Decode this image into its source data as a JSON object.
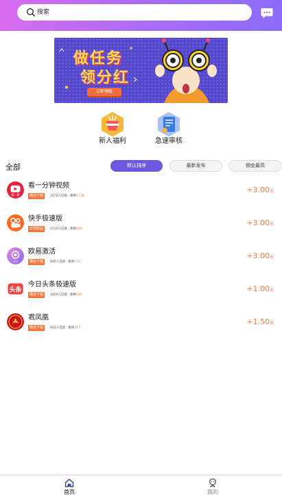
{
  "header": {
    "search_placeholder": "搜索",
    "gradient": [
      "#d86cf0",
      "#8a6cf7"
    ],
    "search_icon": "search-icon",
    "message_icon": "message-icon"
  },
  "banner": {
    "title_line1": "做任务",
    "title_line2": "领分红",
    "button_label": "立即领取"
  },
  "quick_entries": [
    {
      "label": "新人福利",
      "icon": "gift-icon",
      "color": "#f6b73c"
    },
    {
      "label": "急速审核",
      "icon": "document-icon",
      "color": "#5b8ef0"
    }
  ],
  "filters": {
    "all_label": "全部",
    "sort_options": [
      "默认排序",
      "最新发布",
      "佣金最高"
    ],
    "active_index": 0,
    "accent": "#6a5ae0"
  },
  "tasks": [
    {
      "name": "看一分钟视频",
      "tag": "微信下载",
      "meta_main": "2676人已接 · 剩余",
      "meta_remaining": "1736",
      "price": "+3.00",
      "unit": "元",
      "logo": "video-app-logo"
    },
    {
      "name": "快手极速版",
      "tag": "分享收益",
      "meta_main": "4516人已接 · 剩余",
      "meta_remaining": "849",
      "price": "+3.00",
      "unit": "元",
      "logo": "kuaishou-logo"
    },
    {
      "name": "欧易激活",
      "tag": "微信下载",
      "meta_main": "846人已接 · 剩余",
      "meta_remaining": "153",
      "price": "+3.00",
      "unit": "元",
      "logo": "okx-logo"
    },
    {
      "name": "今日头条极速版",
      "tag": "微信下载",
      "meta_main": "2404人已接 · 剩余",
      "meta_remaining": "695",
      "price": "+1.00",
      "unit": "元",
      "logo": "toutiao-logo"
    },
    {
      "name": "君凤凰",
      "tag": "微信下载",
      "meta_main": "681人已接 · 剩余",
      "meta_remaining": "317",
      "price": "+1.50",
      "unit": "元",
      "logo": "phoenix-logo"
    }
  ],
  "price_color": "#f07a3c",
  "bottom_nav": [
    {
      "label": "首页",
      "icon": "home-icon",
      "active": true
    },
    {
      "label": "我的",
      "icon": "user-icon",
      "active": false
    }
  ]
}
